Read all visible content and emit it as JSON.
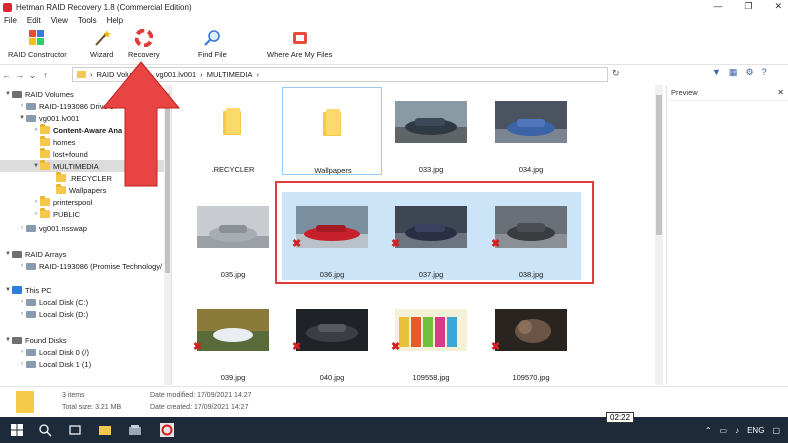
{
  "window": {
    "title": "Hetman RAID Recovery 1.8 (Commercial Edition)",
    "controls": [
      "—",
      "❐",
      "✕"
    ]
  },
  "menu": [
    "File",
    "Edit",
    "View",
    "Tools",
    "Help"
  ],
  "ribbon": [
    {
      "label": "RAID Constructor",
      "icon": "puzzle-icon"
    },
    {
      "label": "Wizard",
      "icon": "wand-icon"
    },
    {
      "label": "Recovery",
      "icon": "lifebuoy-icon"
    },
    {
      "label": "Find File",
      "icon": "magnifier-icon"
    },
    {
      "label": "Where Are My Files",
      "icon": "files-icon"
    }
  ],
  "address": {
    "segments": [
      "RAID Volumes",
      "vg001.lv001",
      "MULTIMEDIA"
    ]
  },
  "tree": {
    "raid_volumes": "RAID Volumes",
    "drive": "RAID-1193086 Drive 0",
    "vg": "vg001.lv001",
    "content_aware": "Content-Aware Ana",
    "homes": "homes",
    "lost": "lost+found",
    "multimedia": "MULTIMEDIA",
    "recycler": ".RECYCLER",
    "wallpapers": "Wallpapers",
    "printerspool": "printerspool",
    "public": "PUBLIC",
    "nsswap": "vg001.nsswap",
    "raid_arrays": "RAID Arrays",
    "array": "RAID-1193086 (Promise Technology/",
    "this_pc": "This PC",
    "disk_c": "Local Disk (C:)",
    "disk_d": "Local Disk (D:)",
    "found_disks": "Found Disks",
    "found0": "Local Disk 0 (/)",
    "found1": "Local Disk 1 (1)"
  },
  "files": [
    {
      "name": ".RECYCLER",
      "kind": "folder"
    },
    {
      "name": "Wallpapers",
      "kind": "folder"
    },
    {
      "name": "033.jpg",
      "kind": "image"
    },
    {
      "name": "034.jpg",
      "kind": "image"
    },
    {
      "name": "035.jpg",
      "kind": "image"
    },
    {
      "name": "036.jpg",
      "kind": "image",
      "deleted": true,
      "selected": true
    },
    {
      "name": "037.jpg",
      "kind": "image",
      "deleted": true,
      "selected": true
    },
    {
      "name": "038.jpg",
      "kind": "image",
      "deleted": true,
      "selected": true
    },
    {
      "name": "039.jpg",
      "kind": "image",
      "deleted": true
    },
    {
      "name": "040.jpg",
      "kind": "image",
      "deleted": true
    },
    {
      "name": "109558.jpg",
      "kind": "image",
      "deleted": true
    },
    {
      "name": "109570.jpg",
      "kind": "image",
      "deleted": true
    }
  ],
  "preview": {
    "title": "Preview"
  },
  "status": {
    "items": "3 items",
    "total_size": "Total size: 3.21 MB",
    "modified": "Date modified: 17/09/2021 14:27",
    "created": "Date created: 17/09/2021 14:27"
  },
  "taskbar": {
    "lang": "ENG",
    "time": "02:22"
  },
  "colors": {
    "accent": "#e03c3c",
    "selection": "#cce4f7",
    "taskbar": "#1c2a3a"
  }
}
